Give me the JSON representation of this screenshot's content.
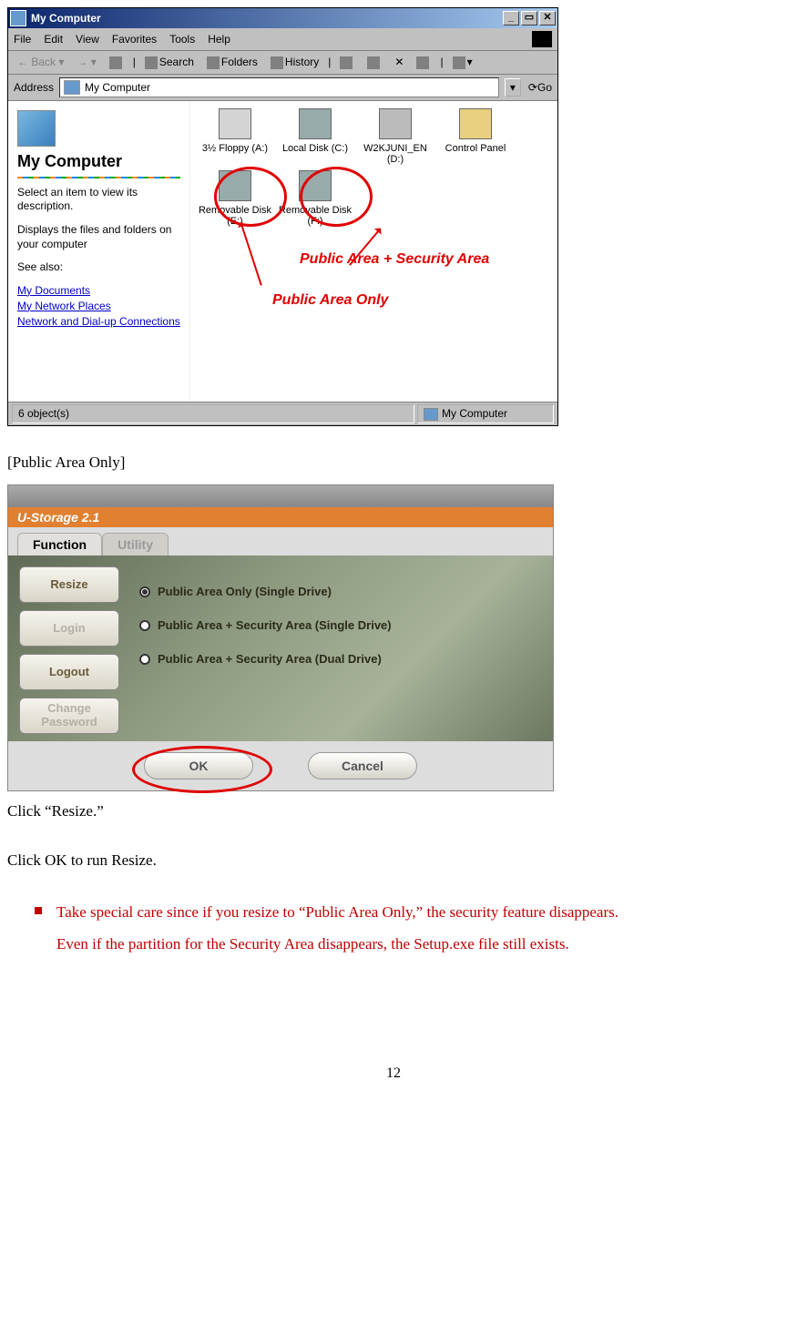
{
  "mycomputer": {
    "title": "My Computer",
    "menu": [
      "File",
      "Edit",
      "View",
      "Favorites",
      "Tools",
      "Help"
    ],
    "toolbar": {
      "back": "Back",
      "search": "Search",
      "folders": "Folders",
      "history": "History"
    },
    "address_label": "Address",
    "address_value": "My Computer",
    "go": "Go",
    "left": {
      "title": "My Computer",
      "line1": "Select an item to view its description.",
      "line2": "Displays the files and folders on your computer",
      "seealso": "See also:",
      "links": [
        "My Documents",
        "My Network Places",
        "Network and Dial-up Connections"
      ]
    },
    "icons_row1": [
      {
        "label": "3½ Floppy (A:)"
      },
      {
        "label": "Local Disk (C:)"
      },
      {
        "label": "W2KJUNI_EN (D:)"
      },
      {
        "label": "Control Panel"
      }
    ],
    "icons_row2": [
      {
        "label": "Removable Disk (E:)"
      },
      {
        "label": "Removable Disk (F:)"
      }
    ],
    "annotation1": "Public Area + Security Area",
    "annotation2": "Public Area Only",
    "status_left": "6 object(s)",
    "status_right": "My Computer"
  },
  "caption1": "[Public Area Only]",
  "ustorage": {
    "brand": "U-Storage 2.1",
    "tabs": {
      "function": "Function",
      "utility": "Utility"
    },
    "side": {
      "resize": "Resize",
      "login": "Login",
      "logout": "Logout",
      "change": "Change Password"
    },
    "opts": {
      "o1": "Public Area Only (Single Drive)",
      "o2": "Public Area + Security Area (Single Drive)",
      "o3": "Public Area + Security Area (Dual Drive)"
    },
    "ok": "OK",
    "cancel": "Cancel"
  },
  "text_click_resize": "Click “Resize.”",
  "text_click_ok": "Click OK to run Resize.",
  "warn1": "Take special care since if you resize to “Public Area Only,” the security feature disappears.",
  "warn2": "Even if the partition for the Security Area disappears, the Setup.exe file still exists.",
  "pagenum": "12"
}
